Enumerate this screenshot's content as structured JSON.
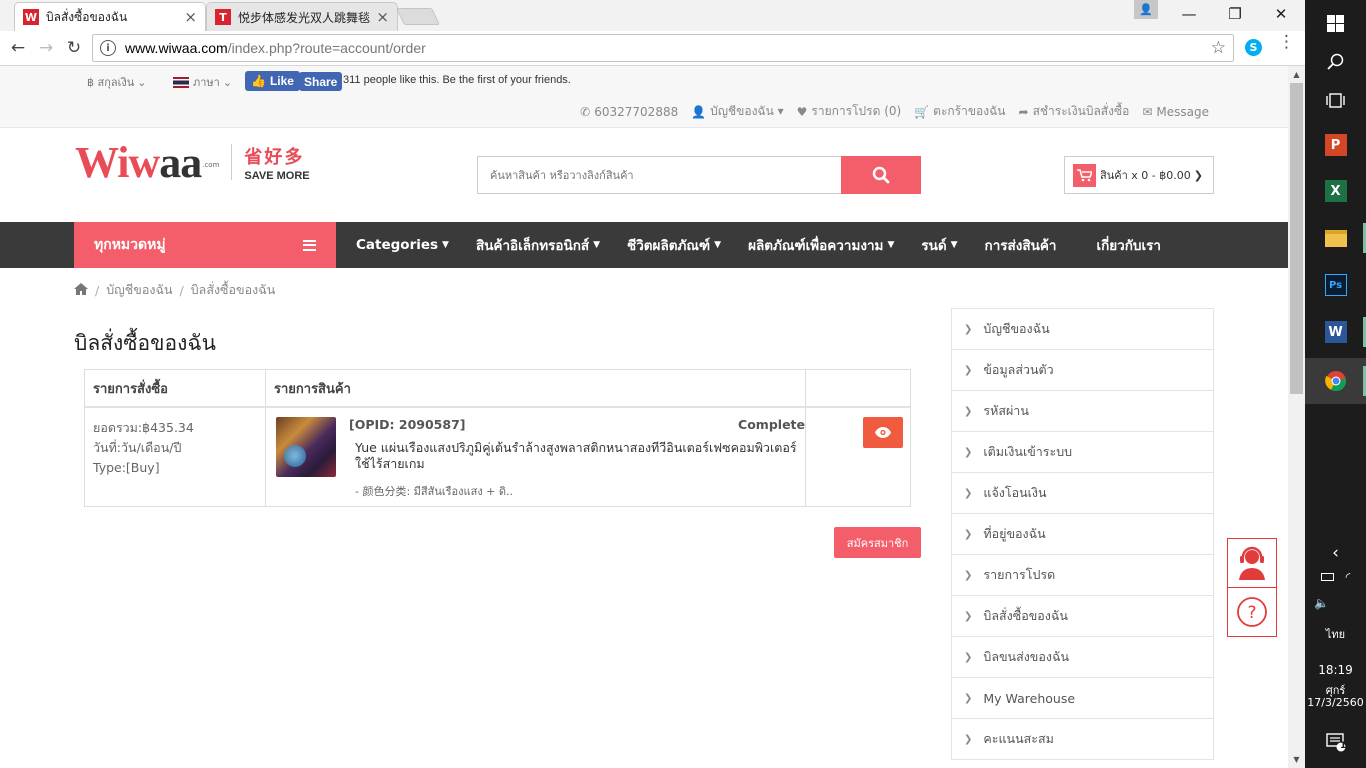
{
  "browser": {
    "tabs": [
      {
        "title": "บิลสั่งซื้อของฉัน",
        "favicon": "W",
        "favicon_color": "#d9232e",
        "active": true
      },
      {
        "title": "悦步体感发光双人跳舞毯",
        "favicon": "T",
        "favicon_color": "#d9232e",
        "active": false
      }
    ],
    "url_host": "www.wiwaa.com",
    "url_path": "/index.php?route=account/order"
  },
  "topbar": {
    "currency_label": "฿ สกุลเงิน",
    "language_label": "ภาษา",
    "fb_like": "Like",
    "fb_share": "Share",
    "fb_text": "311 people like this. Be the first of your friends.",
    "links": [
      {
        "icon": "phone-icon",
        "glyph": "✆",
        "label": "60327702888"
      },
      {
        "icon": "user-icon",
        "glyph": "👤",
        "label": "บัญชีของฉัน ▾"
      },
      {
        "icon": "heart-icon",
        "glyph": "♥",
        "label": "รายการโปรด (0)"
      },
      {
        "icon": "cart-icon",
        "glyph": "🛒",
        "label": "ตะกร้าของฉัน"
      },
      {
        "icon": "share-icon",
        "glyph": "➦",
        "label": "สชำระเงินบิลสั่งซื้อ"
      },
      {
        "icon": "envelope-icon",
        "glyph": "✉",
        "label": "Message"
      }
    ]
  },
  "header": {
    "logo_cn": "省好多",
    "logo_en": "SAVE MORE",
    "logo_com": ".com",
    "search_placeholder": "ค้นหาสินค้า หรือวางลิงก์สินค้า",
    "cart_label": "สินค้า x 0 - ฿0.00"
  },
  "nav": {
    "all_categories": "ทุกหมวดหมู่",
    "items": [
      {
        "label": "Categories",
        "dropdown": true
      },
      {
        "label": "สินค้าอิเล็กทรอนิกส์",
        "dropdown": true
      },
      {
        "label": "ชีวิตผลิตภัณฑ์",
        "dropdown": true
      },
      {
        "label": "ผลิตภัณฑ์เพื่อความงาม",
        "dropdown": true
      },
      {
        "label": "รนด์",
        "dropdown": true
      },
      {
        "label": "การส่งสินค้า",
        "dropdown": false
      },
      {
        "label": "เกี่ยวกับเรา",
        "dropdown": false
      }
    ]
  },
  "breadcrumb": [
    "บัญชีของฉัน",
    "บิลสั่งซื้อของฉัน"
  ],
  "page_title": "บิลสั่งซื้อของฉัน",
  "orders_table": {
    "headers": [
      "รายการสั่งซื้อ",
      "รายการสินค้า",
      ""
    ],
    "rows": [
      {
        "total": "ยอดรวม:฿435.34",
        "date": "วันที่:วัน/เดือน/ปี",
        "type": "Type:[Buy]",
        "opid": "[OPID: 2090587]",
        "status": "Complete",
        "product_name": "Yue แผ่นเรืองแสงปริภูมิคู่เต้นรำล้างสูงพลาสติกหนาสองทีวีอินเตอร์เฟซคอมพิวเตอร์ใช้ไร้สายเกม",
        "option": "- 颜色分类: มีสีสันเรืองแสง + ดิ.."
      }
    ]
  },
  "member_button": "สมัครสมาชิก",
  "sidebar": [
    "บัญชีของฉัน",
    "ข้อมูลส่วนตัว",
    "รหัสผ่าน",
    "เติมเงินเข้าระบบ",
    "แจ้งโอนเงิน",
    "ที่อยู่ของฉัน",
    "รายการโปรด",
    "บิลสั่งซื้อของฉัน",
    "บิลขนส่งของฉัน",
    "My Warehouse",
    "คะแนนสะสม"
  ],
  "taskbar": {
    "language": "ไทย",
    "time": "18:19",
    "day": "ศุกร์",
    "date": "17/3/2560",
    "notification_count": "1"
  },
  "colors": {
    "accent": "#f35e6a",
    "nav_bg": "#3a3a3a",
    "view_button": "#f05a3e",
    "facebook": "#4267b2"
  }
}
